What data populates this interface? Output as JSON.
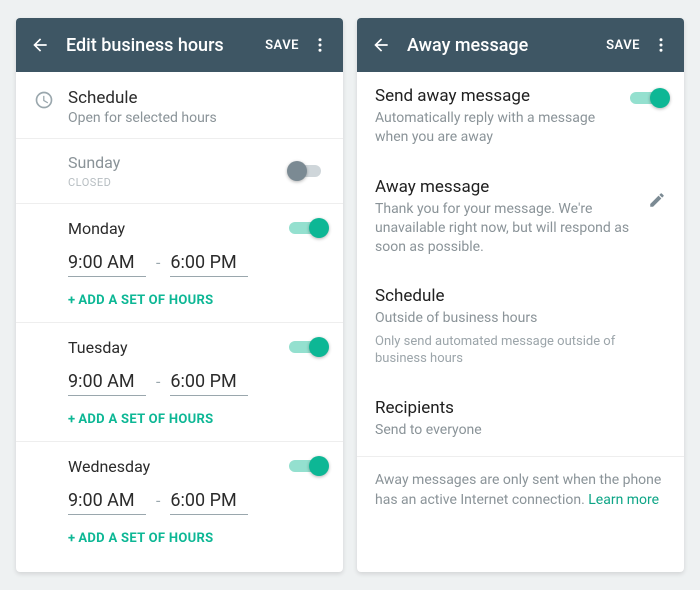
{
  "colors": {
    "accent": "#0db795",
    "appbar": "#3e5664"
  },
  "left": {
    "appbar": {
      "title": "Edit business hours",
      "save": "SAVE"
    },
    "schedule": {
      "title": "Schedule",
      "subtitle": "Open for selected hours"
    },
    "add_hours_label": "ADD A SET OF HOURS",
    "days": {
      "sunday": {
        "name": "Sunday",
        "closed_label": "CLOSED",
        "open": false
      },
      "monday": {
        "name": "Monday",
        "open": true,
        "start": "9:00 AM",
        "end": "6:00 PM"
      },
      "tuesday": {
        "name": "Tuesday",
        "open": true,
        "start": "9:00 AM",
        "end": "6:00 PM"
      },
      "wednesday": {
        "name": "Wednesday",
        "open": true,
        "start": "9:00 AM",
        "end": "6:00 PM"
      }
    }
  },
  "right": {
    "appbar": {
      "title": "Away message",
      "save": "SAVE"
    },
    "send": {
      "title": "Send away message",
      "subtitle": "Automatically reply with a message when you are away",
      "enabled": true
    },
    "message": {
      "title": "Away message",
      "body": "Thank you for your message. We're unavailable right now, but will respond as soon as possible."
    },
    "schedule": {
      "title": "Schedule",
      "subtitle": "Outside of business hours",
      "note": "Only send automated message outside of business hours"
    },
    "recipients": {
      "title": "Recipients",
      "subtitle": "Send to everyone"
    },
    "footer": {
      "text": "Away messages are only sent when the phone has an active Internet connection. ",
      "link": "Learn more"
    }
  }
}
